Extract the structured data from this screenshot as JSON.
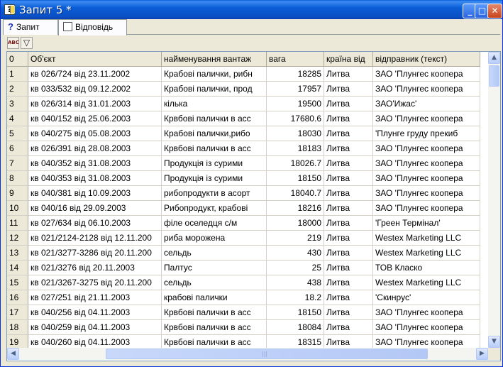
{
  "window": {
    "title": "Запит 5 *"
  },
  "title_buttons": {
    "minimize": "_",
    "maximize": "□",
    "close": "✕"
  },
  "tabs": [
    {
      "label": "Запит",
      "icon": "question-icon"
    },
    {
      "label": "Відповідь",
      "icon": "checkbox-icon"
    }
  ],
  "toolbar": {
    "tool1_label": "ABC",
    "tool2_icon": "filter-icon"
  },
  "grid": {
    "columns": [
      "0",
      "Об'єкт",
      "найменування вантаж",
      "вага",
      "країна від",
      "відправник (текст)"
    ],
    "rows": [
      [
        "1",
        "кв 026/724 від 23.11.2002",
        "Крабові палички, рибн",
        "18285",
        "Литва",
        "ЗАО 'Плунгес коопера"
      ],
      [
        "2",
        "кв 033/532 від 09.12.2002",
        "Крабові палички, прод",
        "17957",
        "Литва",
        "ЗАО 'Плунгес коопера"
      ],
      [
        "3",
        "кв 026/314 від 31.01.2003",
        "кілька",
        "19500",
        "Литва",
        "ЗАО'Ижас'"
      ],
      [
        "4",
        "кв 040/152 від 25.06.2003",
        "Крвбові палички в асс",
        "17680.6",
        "Литва",
        "ЗАО 'Плунгес коопера"
      ],
      [
        "5",
        "кв 040/275 від 05.08.2003",
        " Крабові палички,рибо",
        "18030",
        "Литва",
        "'Плунге груду прекиб"
      ],
      [
        "6",
        "кв 026/391 від 28.08.2003",
        "Крвбові палички в асс",
        "18183",
        "Литва",
        "ЗАО 'Плунгес коопера"
      ],
      [
        "7",
        "кв 040/352 від 31.08.2003",
        "Продукція із сурими",
        "18026.7",
        "Литва",
        "ЗАО 'Плунгес коопера"
      ],
      [
        "8",
        "кв 040/353 від 31.08.2003",
        "Продукція із сурими",
        "18150",
        "Литва",
        "ЗАО 'Плунгес коопера"
      ],
      [
        "9",
        "кв 040/381 від 10.09.2003",
        "рибопродукти в асорт",
        "18040.7",
        "Литва",
        "ЗАО 'Плунгес коопера"
      ],
      [
        "10",
        "кв 040/16 від 29.09.2003",
        "Рибопродукт, крабові",
        "18216",
        "Литва",
        "ЗАО 'Плунгес коопера"
      ],
      [
        "11",
        "кв 027/634 від 06.10.2003",
        "філе оселедця с/м",
        "18000",
        "Литва",
        "'Греен Термінал'"
      ],
      [
        "12",
        "кв 021/2124-2128 від 12.11.200",
        "риба морожена",
        "219",
        "Литва",
        "Westex Marketing LLC"
      ],
      [
        "13",
        "кв 021/3277-3286 від 20.11.200",
        "сельдь",
        "430",
        "Литва",
        "Westex Marketing LLC"
      ],
      [
        "14",
        "кв 021/3276 від 20.11.2003",
        "Палтус",
        "25",
        "Литва",
        "ТОВ Класко"
      ],
      [
        "15",
        "кв 021/3267-3275 від 20.11.200",
        "сельдь",
        "438",
        "Литва",
        "Westex Marketing LLC"
      ],
      [
        "16",
        "кв 027/251 від 21.11.2003",
        "крабові палички",
        "18.2",
        "Литва",
        "'Скинрус'"
      ],
      [
        "17",
        "кв 040/256 від 04.11.2003",
        "Крвбові палички в асс",
        "18150",
        "Литва",
        "ЗАО 'Плунгес коопера"
      ],
      [
        "18",
        "кв 040/259 від 04.11.2003",
        "Крвбові палички в асс",
        "18084",
        "Литва",
        "ЗАО 'Плунгес коопера"
      ],
      [
        "19",
        "кв 040/260 від 04.11.2003",
        "Крвбові палички в асс",
        "18315",
        "Литва",
        "ЗАО 'Плунгес коопера"
      ]
    ]
  },
  "scrollbars": {
    "up": "▲",
    "down": "▼",
    "left": "◀",
    "right": "▶",
    "grip": "|||"
  }
}
